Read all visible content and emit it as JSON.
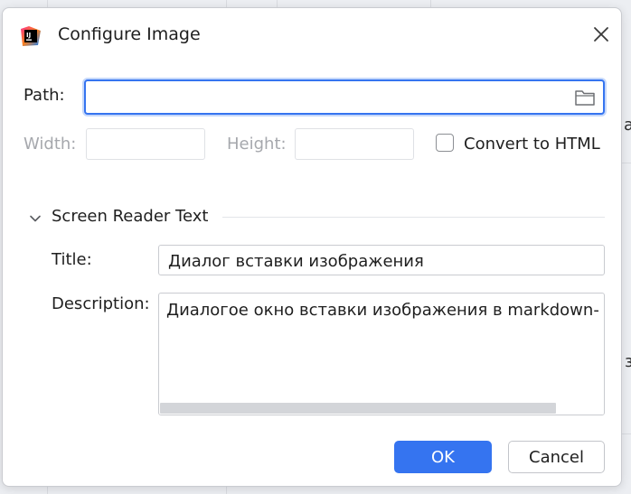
{
  "background": {
    "fragments": [
      "а",
      "з"
    ]
  },
  "dialog": {
    "title": "Configure Image",
    "icons": {
      "app": "intellij-idea-icon",
      "close": "close-icon",
      "folder": "folder-icon",
      "section_toggle": "chevron-down-icon"
    },
    "path": {
      "label": "Path:",
      "value": ""
    },
    "width": {
      "label": "Width:",
      "value": ""
    },
    "height": {
      "label": "Height:",
      "value": ""
    },
    "convert_to_html": {
      "label": "Convert to HTML",
      "checked": false
    },
    "screen_reader": {
      "section_title": "Screen Reader Text",
      "title_label": "Title:",
      "title_value": "Диалог вставки изображения",
      "description_label": "Description:",
      "description_value": "Диалогое окно вставки изображения в markdown-"
    },
    "buttons": {
      "ok": "OK",
      "cancel": "Cancel"
    }
  },
  "colors": {
    "accent": "#3574f0",
    "text": "#1f1f1f",
    "disabled_text": "#a6a8ad"
  }
}
